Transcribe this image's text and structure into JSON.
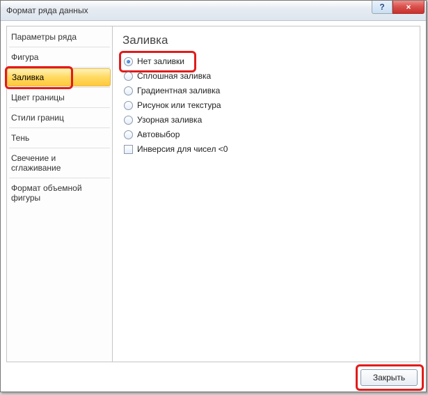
{
  "titlebar": {
    "title": "Формат ряда данных",
    "help": "?",
    "close": "×"
  },
  "sidebar": {
    "items": [
      {
        "label": "Параметры ряда"
      },
      {
        "label": "Фигура"
      },
      {
        "label": "Заливка",
        "selected": true
      },
      {
        "label": "Цвет границы"
      },
      {
        "label": "Стили границ"
      },
      {
        "label": "Тень"
      },
      {
        "label": "Свечение и сглаживание"
      },
      {
        "label": "Формат объемной фигуры"
      }
    ]
  },
  "panel": {
    "title": "Заливка",
    "options": [
      {
        "type": "radio",
        "label": "Нет заливки",
        "checked": true
      },
      {
        "type": "radio",
        "label": "Сплошная заливка"
      },
      {
        "type": "radio",
        "label": "Градиентная заливка"
      },
      {
        "type": "radio",
        "label": "Рисунок или текстура"
      },
      {
        "type": "radio",
        "label": "Узорная заливка"
      },
      {
        "type": "radio",
        "label": "Автовыбор"
      },
      {
        "type": "checkbox",
        "label": "Инверсия для чисел <0"
      }
    ]
  },
  "footer": {
    "close_label": "Закрыть"
  }
}
